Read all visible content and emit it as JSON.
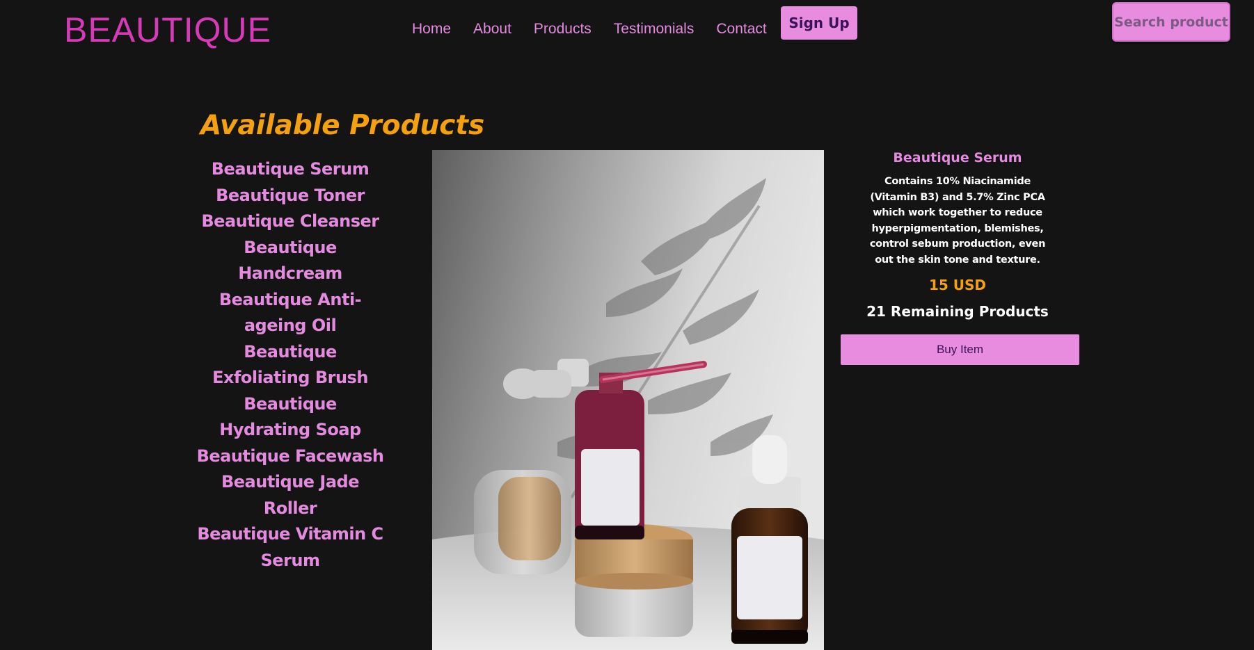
{
  "header": {
    "logo": "BEAUTIQUE",
    "nav": [
      "Home",
      "About",
      "Products",
      "Testimonials",
      "Contact"
    ],
    "signup_label": "Sign Up",
    "search_placeholder": "Search product"
  },
  "main": {
    "heading": "Available Products",
    "products": [
      "Beautique Serum",
      "Beautique Toner",
      "Beautique Cleanser",
      "Beautique Handcream",
      "Beautique Anti-ageing Oil",
      "Beautique Exfoliating Brush",
      "Beautique Hydrating Soap",
      "Beautique Facewash",
      "Beautique Jade Roller",
      "Beautique Vitamin C Serum"
    ],
    "selected": {
      "name": "Beautique Serum",
      "description": "Contains 10% Niacinamide (Vitamin B3) and 5.7% Zinc PCA which work together to reduce hyperpigmentation, blemishes, control sebum production, even out the skin tone and texture.",
      "price": "15 USD",
      "remaining": "21 Remaining Products",
      "buy_label": "Buy Item"
    }
  },
  "colors": {
    "background": "#141414",
    "accent": "#e88ce0",
    "logo": "#d63ab8",
    "highlight": "#f5a00f"
  }
}
